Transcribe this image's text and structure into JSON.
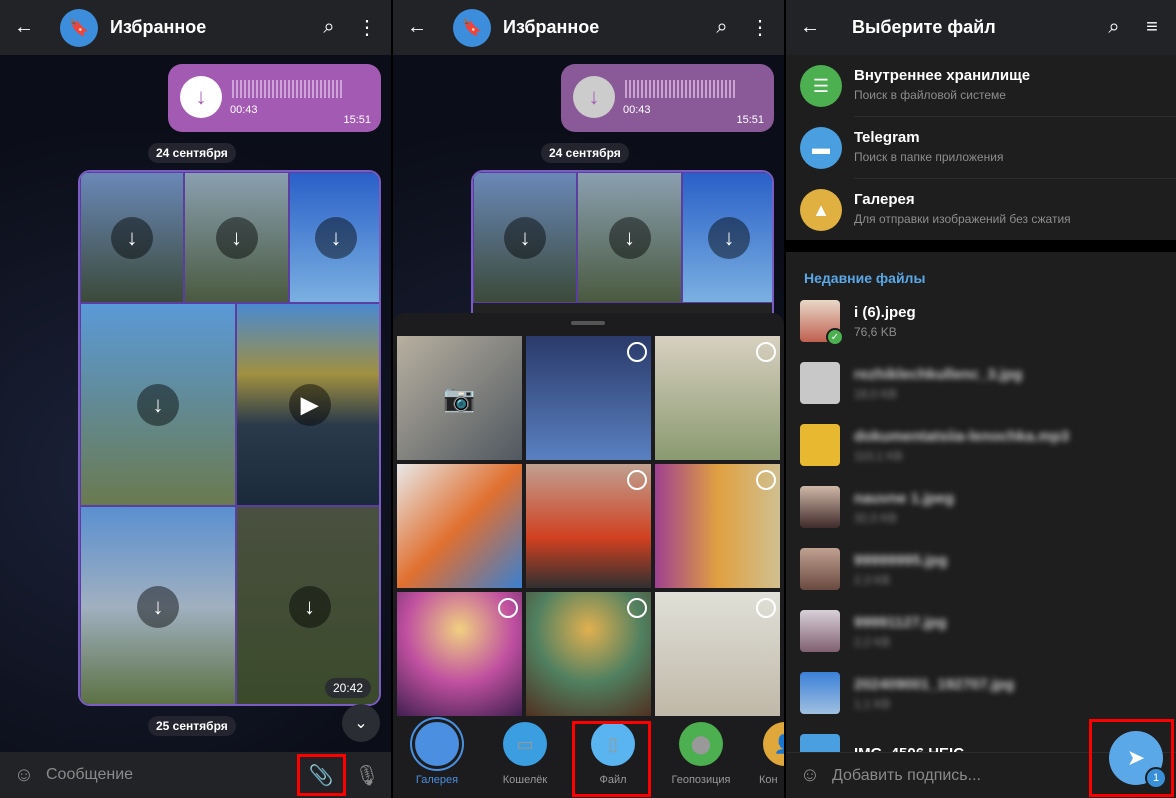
{
  "panel1": {
    "title": "Избранное",
    "voice": {
      "duration": "00:43",
      "time": "15:51"
    },
    "date1": "24 сентября",
    "album_time": "20:42",
    "date2": "25 сентября",
    "input_placeholder": "Сообщение"
  },
  "panel2": {
    "title": "Избранное",
    "voice": {
      "duration": "00:43",
      "time": "15:51"
    },
    "date1": "24 сентября",
    "tabs": [
      {
        "label": "Галерея",
        "color": "#4a8fe0"
      },
      {
        "label": "Кошелёк",
        "color": "#3a9ee0"
      },
      {
        "label": "Файл",
        "color": "#5ab4f0"
      },
      {
        "label": "Геопозиция",
        "color": "#4caf50"
      },
      {
        "label": "Кон",
        "color": "#e0a83a"
      }
    ]
  },
  "panel3": {
    "title": "Выберите файл",
    "sources": [
      {
        "title": "Внутреннее хранилище",
        "subtitle": "Поиск в файловой системе",
        "color": "#4caf50"
      },
      {
        "title": "Telegram",
        "subtitle": "Поиск в папке приложения",
        "color": "#4a9fe0"
      },
      {
        "title": "Галерея",
        "subtitle": "Для отправки изображений без сжатия",
        "color": "#e0b040"
      }
    ],
    "recent_header": "Недавние файлы",
    "files": [
      {
        "name": "i (6).jpeg",
        "size": "76,6 KB"
      },
      {
        "name": "rezhiklechkullenc_3.jpg",
        "size": "18,0 KB"
      },
      {
        "name": "dokumentatsiia-lenochka.mp3",
        "size": "110,1 KB"
      },
      {
        "name": "nauvne 1.jpeg",
        "size": "32,0 KB"
      },
      {
        "name": "99999995.jpg",
        "size": "2,3 KB"
      },
      {
        "name": "99991127.jpg",
        "size": "2,2 KB"
      },
      {
        "name": "202409001_192707.jpg",
        "size": "1,1 KB"
      },
      {
        "name": "IMG_4506.HEIC",
        "size": ""
      }
    ],
    "caption_placeholder": "Добавить подпись...",
    "selected_count": "1"
  }
}
